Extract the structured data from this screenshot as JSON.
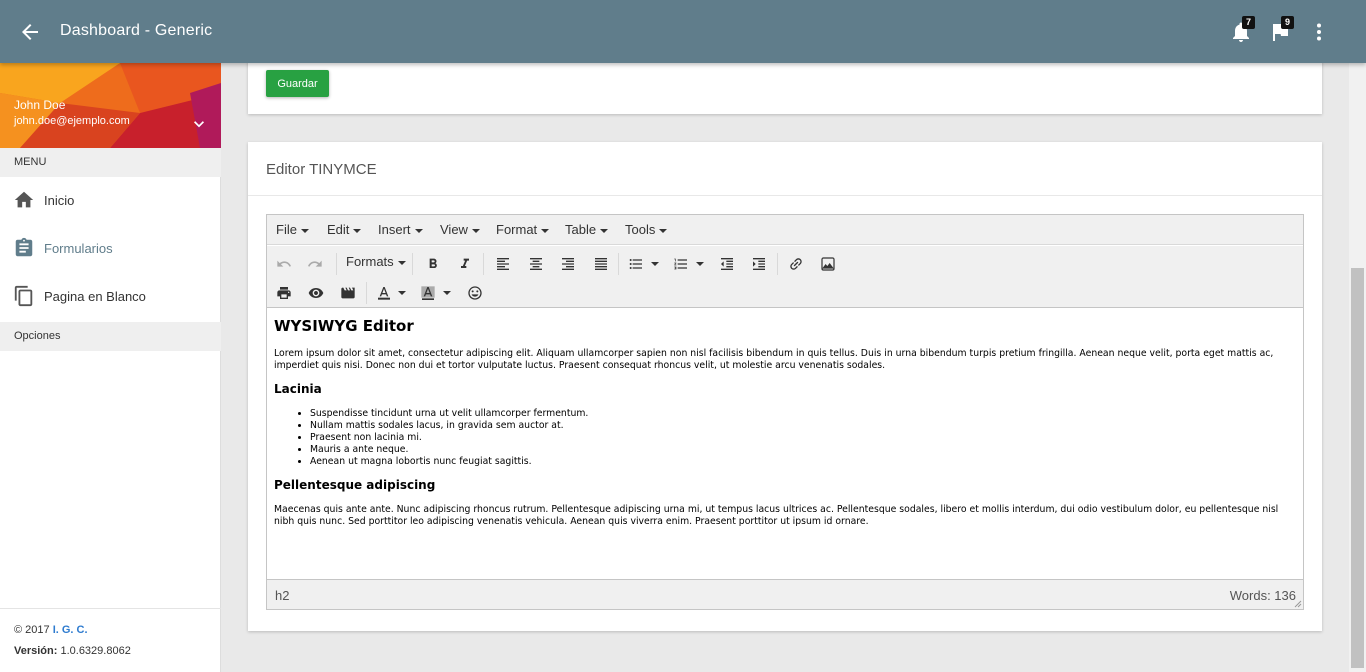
{
  "header": {
    "title": "Dashboard - Generic",
    "notifications_count": "7",
    "flags_count": "9"
  },
  "profile": {
    "name": "John Doe",
    "email": "john.doe@ejemplo.com"
  },
  "sidebar": {
    "menu_label": "MENU",
    "items": [
      {
        "label": "Inicio",
        "icon": "home-icon"
      },
      {
        "label": "Formularios",
        "icon": "clipboard-icon",
        "active": true
      },
      {
        "label": "Pagina en Blanco",
        "icon": "copy-icon"
      }
    ],
    "options_label": "Opciones"
  },
  "footer": {
    "copyright_prefix": "© 2017",
    "copyright_brand": "I. G. C.",
    "version_label": "Versión:",
    "version_value": "1.0.6329.8062"
  },
  "form": {
    "save_label": "Guardar"
  },
  "editor_card": {
    "title": "Editor TINYMCE"
  },
  "editor": {
    "menus": [
      "File",
      "Edit",
      "Insert",
      "View",
      "Format",
      "Table",
      "Tools"
    ],
    "formats_label": "Formats",
    "content": {
      "heading": "WYSIWYG Editor",
      "paragraph1": "Lorem ipsum dolor sit amet, consectetur adipiscing elit. Aliquam ullamcorper sapien non nisl facilisis bibendum in quis tellus. Duis in urna bibendum turpis pretium fringilla. Aenean neque velit, porta eget mattis ac, imperdiet quis nisi. Donec non dui et tortor vulputate luctus. Praesent consequat rhoncus velit, ut molestie arcu venenatis sodales.",
      "subheading1": "Lacinia",
      "list": [
        "Suspendisse tincidunt urna ut velit ullamcorper fermentum.",
        "Nullam mattis sodales lacus, in gravida sem auctor at.",
        "Praesent non lacinia mi.",
        "Mauris a ante neque.",
        "Aenean ut magna lobortis nunc feugiat sagittis."
      ],
      "subheading2": "Pellentesque adipiscing",
      "paragraph2": "Maecenas quis ante ante. Nunc adipiscing rhoncus rutrum. Pellentesque adipiscing urna mi, ut tempus lacus ultrices ac. Pellentesque sodales, libero et mollis interdum, dui odio vestibulum dolor, eu pellentesque nisl nibh quis nunc. Sed porttitor leo adipiscing venenatis vehicula. Aenean quis viverra enim. Praesent porttitor ut ipsum id ornare."
    },
    "status_path": "h2",
    "word_count": "Words: 136"
  },
  "colors": {
    "topbar": "#607d8b",
    "save_button": "#28a142",
    "brand_link": "#2e7bcf"
  }
}
